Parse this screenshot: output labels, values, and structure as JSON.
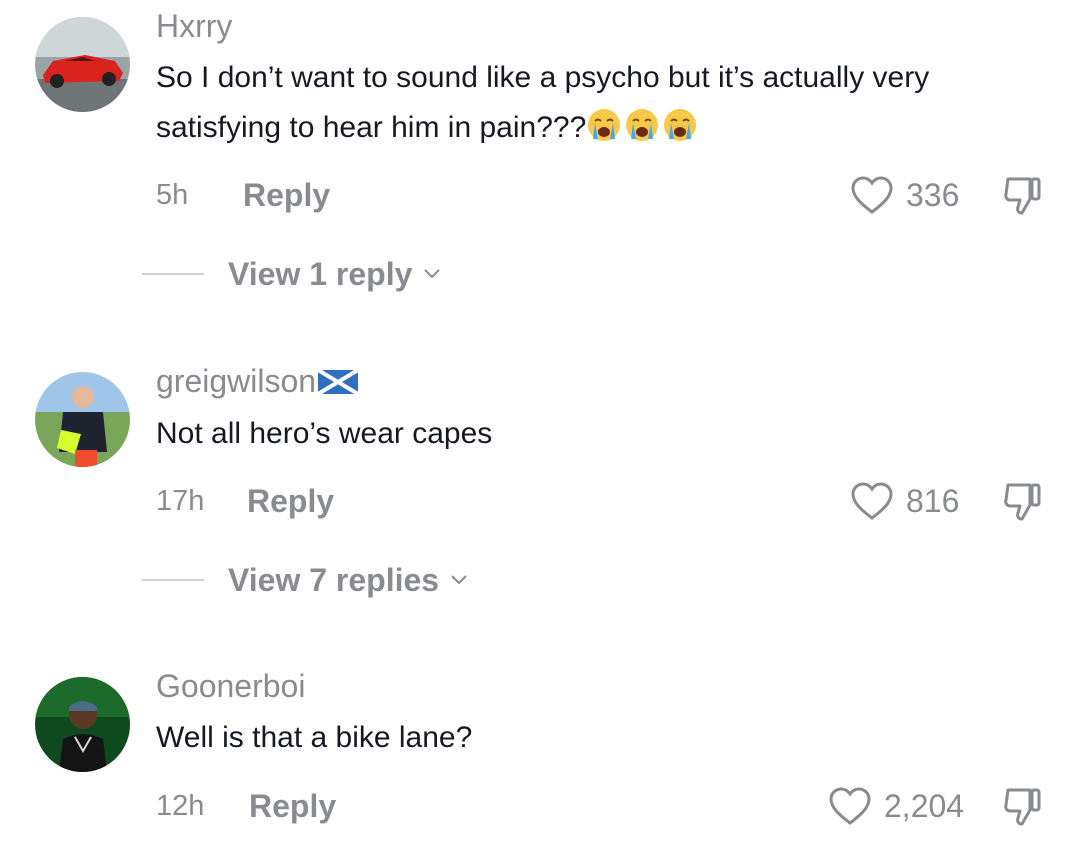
{
  "comments": [
    {
      "username": "Hxrry",
      "text": "So I don’t want to sound like a psycho but it’s actually very satisfying to hear him in pain???",
      "emoji": [
        "loudly-crying-face",
        "loudly-crying-face",
        "loudly-crying-face"
      ],
      "time": "5h",
      "reply_label": "Reply",
      "likes": "336",
      "view_replies": "View 1 reply"
    },
    {
      "username": "greigwilson",
      "flag": "scotland-flag",
      "text": "Not all hero’s wear capes",
      "time": "17h",
      "reply_label": "Reply",
      "likes": "816",
      "view_replies": "View 7 replies"
    },
    {
      "username": "Goonerboi",
      "text": "Well is that a bike lane?",
      "time": "12h",
      "reply_label": "Reply",
      "likes": "2,204"
    }
  ],
  "colors": {
    "secondary_text": "#8a8b91",
    "primary_text": "#161823"
  }
}
